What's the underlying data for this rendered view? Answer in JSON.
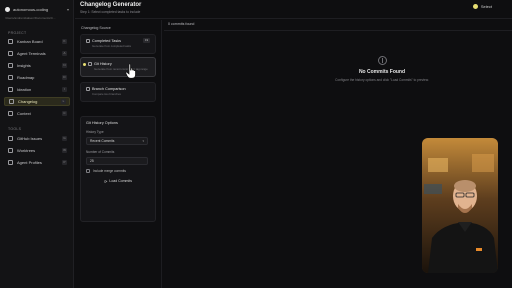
{
  "sidebar": {
    "workspace": "autonomous-coding",
    "workspace_path": "/Users/andremikalsen/Documents/C...",
    "project_section": "PROJECT",
    "tools_section": "TOOLS",
    "items": [
      {
        "label": "Kanban Board",
        "key": "K"
      },
      {
        "label": "Agent Terminals",
        "key": "A"
      },
      {
        "label": "Insights",
        "key": "N"
      },
      {
        "label": "Roadmap",
        "key": "D"
      },
      {
        "label": "Ideation",
        "key": "I"
      },
      {
        "label": "Changelog",
        "key": "L",
        "active": true
      },
      {
        "label": "Context",
        "key": "C"
      }
    ],
    "tools": [
      {
        "label": "GitHub Issues",
        "key": "G"
      },
      {
        "label": "Worktrees",
        "key": "W"
      },
      {
        "label": "Agent Profiles",
        "key": "P"
      }
    ]
  },
  "header": {
    "title": "Changelog Generator",
    "subtitle": "Step 1: Select completed tasks to include",
    "right_label": "Select"
  },
  "source": {
    "heading": "Changelog Source",
    "cards": [
      {
        "title": "Completed Tasks",
        "desc": "Generate from completed tasks",
        "badge": "19"
      },
      {
        "title": "Git History",
        "desc": "Generate from recent commits or tag range",
        "selected": true
      },
      {
        "title": "Branch Comparison",
        "desc": "Compare two branches"
      }
    ]
  },
  "options": {
    "heading": "Git History Options",
    "history_type_label": "History Type",
    "history_type_value": "Recent Commits",
    "count_label": "Number of Commits",
    "count_value": "25",
    "merge_label": "Include merge commits",
    "load_button": "Load Commits"
  },
  "commits": {
    "count_label": "0 commits found",
    "empty_title": "No Commits Found",
    "empty_desc": "Configure the history options and click \"Load Commits\" to preview."
  },
  "colors": {
    "accent": "#e6dd72",
    "background": "#0e0e10",
    "sidebar": "#131315"
  },
  "icons": {
    "workspace": "circle-icon",
    "refresh": "refresh-icon",
    "empty_state": "git-commit-icon",
    "cursor": "hand-pointer-icon"
  }
}
